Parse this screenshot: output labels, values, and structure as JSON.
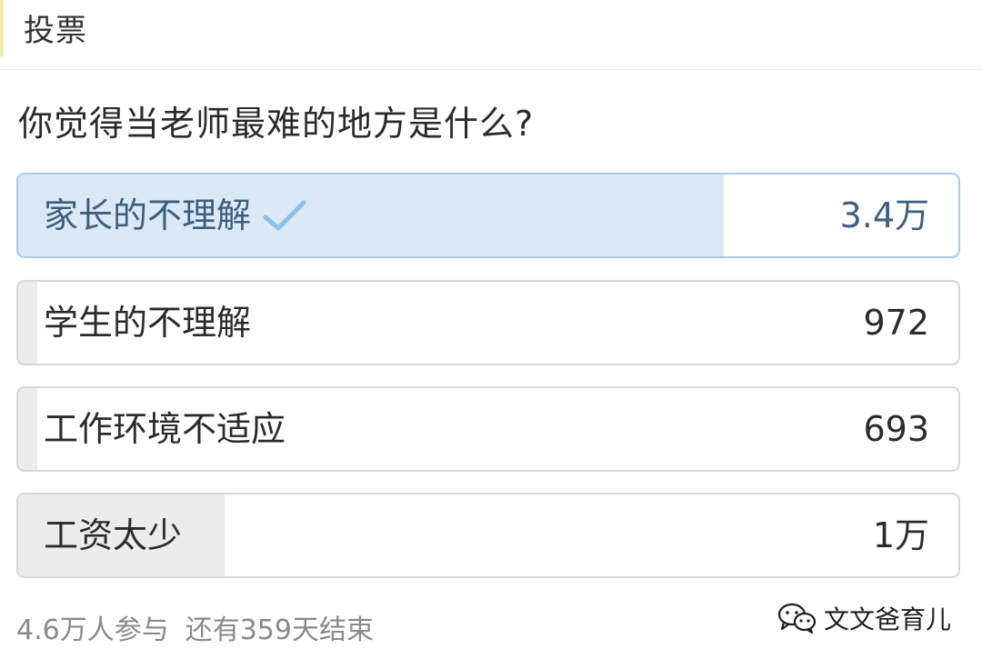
{
  "header": {
    "title": "投票"
  },
  "poll": {
    "question": "你觉得当老师最难的地方是什么?",
    "options": [
      {
        "label": "家长的不理解",
        "count": "3.4万",
        "share": 0.75,
        "selected": true
      },
      {
        "label": "学生的不理解",
        "count": "972",
        "share": 0.02,
        "selected": false
      },
      {
        "label": "工作环境不适应",
        "count": "693",
        "share": 0.015,
        "selected": false
      },
      {
        "label": "工资太少",
        "count": "1万",
        "share": 0.22,
        "selected": false
      }
    ],
    "participants": "4.6万人参与",
    "remaining": "还有359天结束"
  },
  "watermark": {
    "text": "文文爸育儿",
    "icon": "wechat-icon"
  },
  "colors": {
    "selected_fill": "#dbe9f6",
    "selected_border": "#a6cbe8",
    "selected_text": "#3d5f80",
    "fill": "#ececec",
    "border": "#d7d7d7",
    "check": "#8ec0e8",
    "muted_text": "#8a8a8a"
  }
}
